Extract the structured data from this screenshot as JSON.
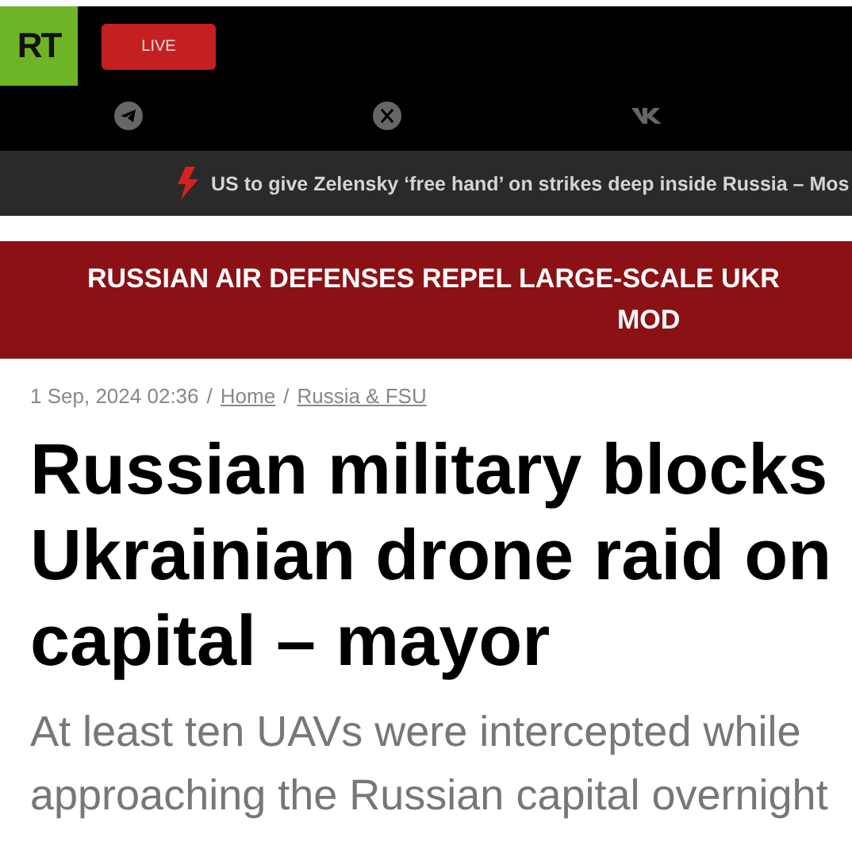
{
  "header": {
    "logo": "RT",
    "live_button": "LIVE"
  },
  "ticker": {
    "text": "US to give Zelensky ‘free hand’ on strikes deep inside Russia – Mos"
  },
  "banner": {
    "lines": [
      "RUSSIAN AIR DEFENSES REPEL LARGE-SCALE UKR",
      "MOD"
    ]
  },
  "article": {
    "date": "1 Sep, 2024 02:36",
    "breadcrumbs": [
      "Home",
      "Russia & FSU"
    ],
    "separator": "/",
    "title": "Russian military blocks Ukrainian drone raid on capital – mayor",
    "summary": "At least ten UAVs were intercepted while approaching the Russian capital overnight"
  }
}
